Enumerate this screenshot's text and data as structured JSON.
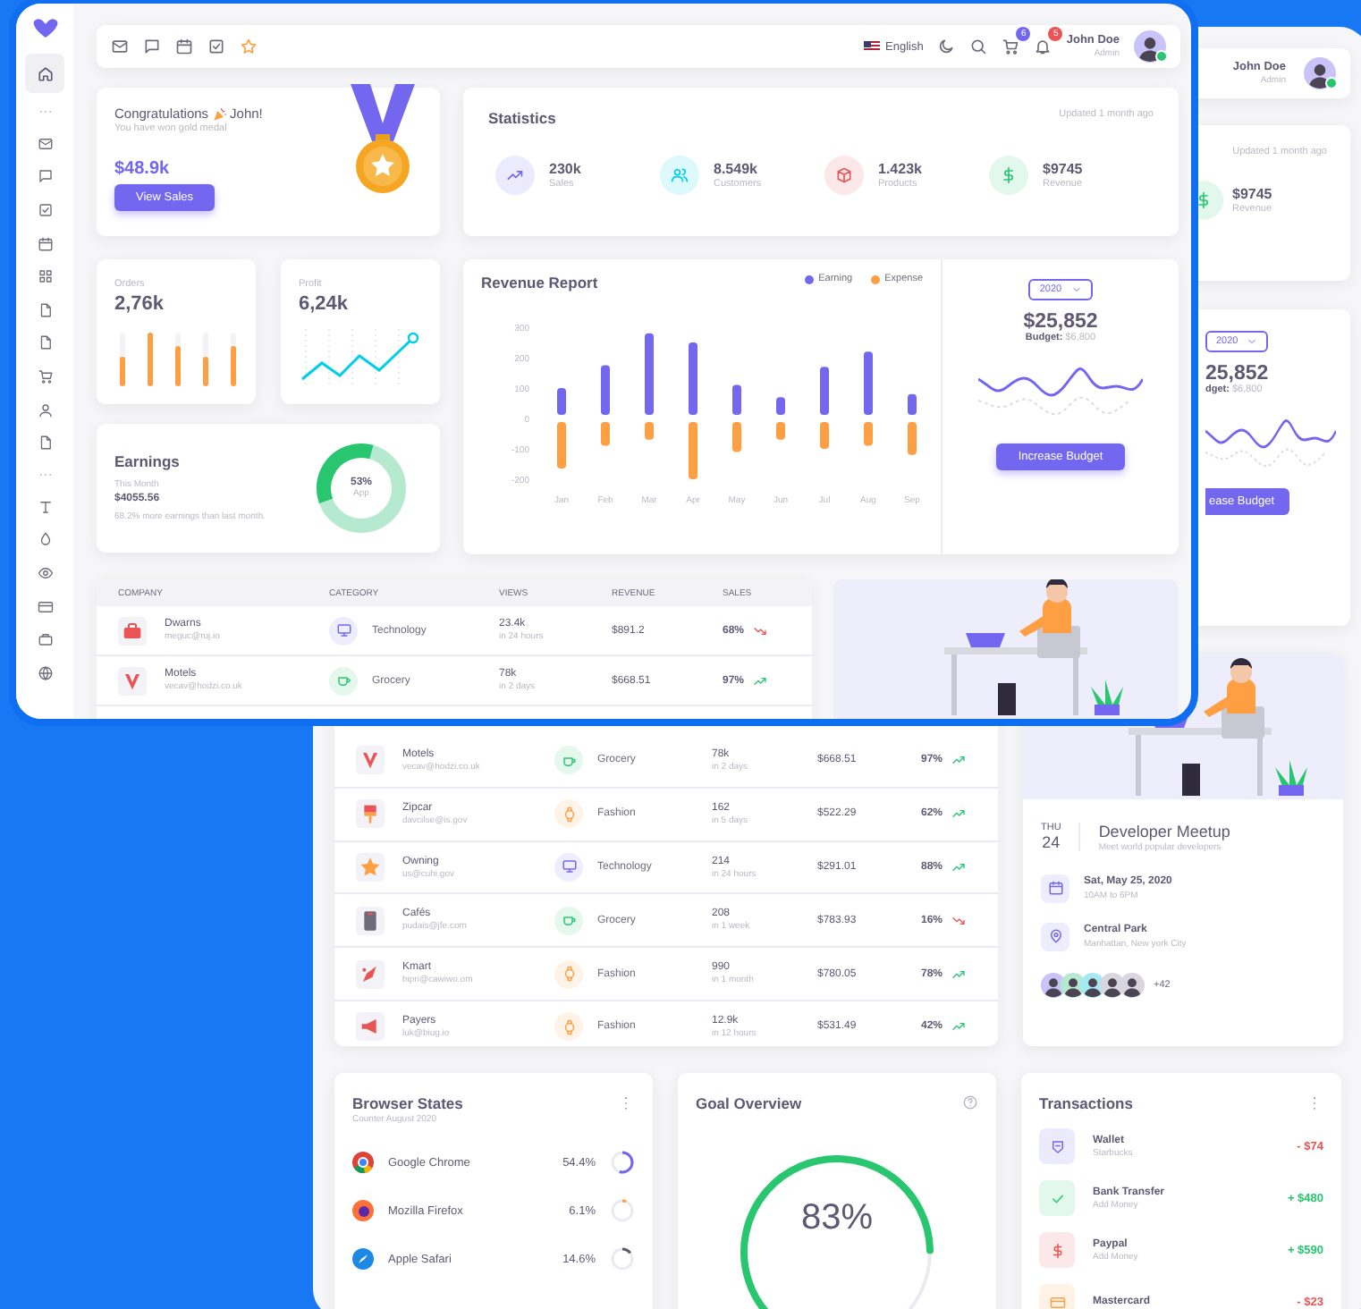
{
  "front_window": {
    "sidebar": {
      "items": [
        {
          "kind": "logo"
        },
        {
          "kind": "link",
          "selected": true
        },
        {
          "kind": "divider"
        },
        {
          "kind": "link",
          "selected": false
        },
        {
          "kind": "link",
          "selected": false
        },
        {
          "kind": "link",
          "selected": false
        },
        {
          "kind": "link",
          "selected": false
        },
        {
          "kind": "link",
          "selected": false
        },
        {
          "kind": "link",
          "selected": false
        },
        {
          "kind": "link",
          "selected": false
        },
        {
          "kind": "link",
          "selected": false
        },
        {
          "kind": "link",
          "selected": false
        },
        {
          "kind": "link",
          "selected": false
        },
        {
          "kind": "divider"
        },
        {
          "kind": "link",
          "selected": false
        },
        {
          "kind": "link",
          "selected": false
        },
        {
          "kind": "link",
          "selected": false
        },
        {
          "kind": "link",
          "selected": false
        },
        {
          "kind": "link",
          "selected": false
        },
        {
          "kind": "link",
          "selected": false
        }
      ]
    },
    "top_bar": {
      "language": "English",
      "cart_badge": "6",
      "notification_badge": "5",
      "user": {
        "name": "John Doe",
        "role": "Admin",
        "online": true
      }
    },
    "congrats": {
      "title": "Congratulations",
      "name": "John!",
      "subtitle": "You have won gold medal",
      "amount": "$48.9k",
      "button": "View Sales"
    },
    "statistics": {
      "title": "Statistics",
      "updated": "Updated 1 month ago",
      "items": [
        {
          "value": "230k",
          "label": "Sales",
          "color": "#7367f0"
        },
        {
          "value": "8.549k",
          "label": "Customers",
          "color": "#00cfe8"
        },
        {
          "value": "1.423k",
          "label": "Products",
          "color": "#ea5455"
        },
        {
          "value": "$9745",
          "label": "Revenue",
          "color": "#28c76f"
        }
      ]
    },
    "orders": {
      "title": "Orders",
      "value": "2,76k"
    },
    "profit": {
      "title": "Profit",
      "value": "6,24k"
    },
    "earnings": {
      "title": "Earnings",
      "period": "This Month",
      "amount": "$4055.56",
      "note": "68.2% more earnings than last month.",
      "donut_value": "53%",
      "donut_label": "App"
    },
    "revenue_report": {
      "title": "Revenue Report",
      "chart_data": {
        "type": "bar",
        "stacked": true,
        "categories": [
          "Jan",
          "Feb",
          "Mar",
          "Apr",
          "May",
          "Jun",
          "Jul",
          "Aug",
          "Sep"
        ],
        "ylim": [
          -200,
          300
        ],
        "yticks": [
          300,
          200,
          100,
          0,
          -100,
          -200
        ],
        "series": [
          {
            "name": "Earning",
            "color": "#7367f0",
            "values": [
              100,
              175,
              280,
              250,
              110,
              70,
              170,
              220,
              80
            ]
          },
          {
            "name": "Expense",
            "color": "#ff9f43",
            "values": [
              -165,
              -90,
              -70,
              -200,
              -110,
              -70,
              -100,
              -90,
              -120
            ]
          }
        ]
      }
    },
    "budget": {
      "year": "2020",
      "amount": "$25,852",
      "budget": "**Budget:** $6,800",
      "button": "Increase Budget"
    },
    "table": {
      "columns": [
        "COMPANY",
        "CATEGORY",
        "VIEWS",
        "REVENUE",
        "SALES"
      ],
      "rows": [
        {
          "company": "Dwarns",
          "email": "meguc@ruj.io",
          "category": {
            "label": "Technology",
            "kind": "technology"
          },
          "views": "23.4k",
          "period": "in 24 hours",
          "revenue": "$891.2",
          "sales": "68%",
          "trend_up": false
        },
        {
          "company": "Motels",
          "email": "vecav@hodzi.co.uk",
          "category": {
            "label": "Grocery",
            "kind": "grocery"
          },
          "views": "78k",
          "period": "in 2 days",
          "revenue": "$668.51",
          "sales": "97%",
          "trend_up": true
        }
      ]
    }
  },
  "back_window": {
    "top_bar": {
      "user": {
        "name": "John Doe",
        "role": "Admin",
        "online": true
      }
    },
    "statistics": {
      "updated": "Updated 1 month ago",
      "item": {
        "value": "$9745",
        "label": "Revenue"
      }
    },
    "budget": {
      "year": "2020",
      "amount": "25,852",
      "budget": "**dget:** $6,800",
      "button": "ease Budget"
    },
    "table": {
      "rows": [
        {
          "company": "Motels",
          "email": "vecav@hodzi.co.uk",
          "category": {
            "label": "Grocery",
            "kind": "grocery"
          },
          "views": "78k",
          "period": "in 2 days",
          "revenue": "$668.51",
          "sales": "97%",
          "trend_up": true
        },
        {
          "company": "Zipcar",
          "email": "davcilse@is.gov",
          "category": {
            "label": "Fashion",
            "kind": "fashion"
          },
          "views": "162",
          "period": "in 5 days",
          "revenue": "$522.29",
          "sales": "62%",
          "trend_up": true
        },
        {
          "company": "Owning",
          "email": "us@cuhi.gov",
          "category": {
            "label": "Technology",
            "kind": "technology"
          },
          "views": "214",
          "period": "in 24 hours",
          "revenue": "$291.01",
          "sales": "88%",
          "trend_up": true
        },
        {
          "company": "Cafés",
          "email": "pudais@jfe.com",
          "category": {
            "label": "Grocery",
            "kind": "grocery"
          },
          "views": "208",
          "period": "in 1 week",
          "revenue": "$783.93",
          "sales": "16%",
          "trend_up": false
        },
        {
          "company": "Kmart",
          "email": "bipri@cawiwo.om",
          "category": {
            "label": "Fashion",
            "kind": "fashion"
          },
          "views": "990",
          "period": "in 1 month",
          "revenue": "$780.05",
          "sales": "78%",
          "trend_up": true
        },
        {
          "company": "Payers",
          "email": "luk@biug.io",
          "category": {
            "label": "Fashion",
            "kind": "fashion"
          },
          "views": "12.9k",
          "period": "in 12 hours",
          "revenue": "$531.49",
          "sales": "42%",
          "trend_up": true
        }
      ]
    },
    "event": {
      "day": "THU",
      "date": "24",
      "title": "Developer Meetup",
      "subtitle": "Meet world popular developers",
      "details": [
        {
          "title": "Sat, May 25, 2020",
          "subtitle": "10AM to 6PM"
        },
        {
          "title": "Central Park",
          "subtitle": "Manhattan, New york City"
        }
      ],
      "attendee_count": "+42"
    },
    "browser_states": {
      "title": "Browser States",
      "subtitle": "Counter August 2020",
      "items": [
        {
          "name": "Google Chrome",
          "value": "54.4%",
          "level": 0.544,
          "color": "#7367f0"
        },
        {
          "name": "Mozilla Firefox",
          "value": "6.1%",
          "level": 0.061,
          "color": "#ff9f43"
        },
        {
          "name": "Apple Safari",
          "value": "14.6%",
          "level": 0.146,
          "color": "#5e5873"
        }
      ]
    },
    "goal_overview": {
      "title": "Goal Overview",
      "value": "83%"
    },
    "transactions": {
      "title": "Transactions",
      "items": [
        {
          "title": "Wallet",
          "subtitle": "Starbucks",
          "amount": "- $74",
          "credit": false,
          "color": "#7367f0"
        },
        {
          "title": "Bank Transfer",
          "subtitle": "Add Money",
          "amount": "+ $480",
          "credit": true,
          "color": "#28c76f"
        },
        {
          "title": "Paypal",
          "subtitle": "Add Money",
          "amount": "+ $590",
          "credit": true,
          "color": "#ea5455"
        },
        {
          "title": "Mastercard",
          "amount": "- $23",
          "credit": false,
          "color": "#ff9f43"
        }
      ]
    }
  }
}
